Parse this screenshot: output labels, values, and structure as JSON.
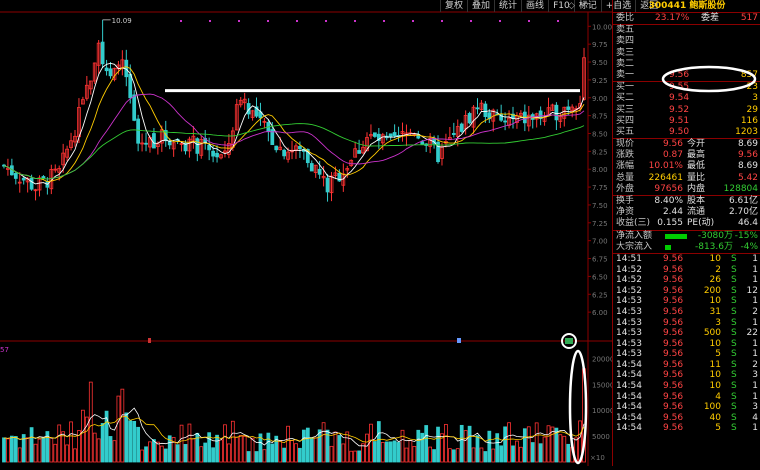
{
  "toolbar": {
    "buttons": [
      "复权",
      "叠加",
      "统计",
      "画线",
      "F10",
      "标记",
      "+自选",
      "返回"
    ],
    "icons": [
      "◇",
      "↶"
    ]
  },
  "stock": {
    "code": "300441",
    "name": "鲍斯股份",
    "code_name": "300441  鲍斯股份"
  },
  "order_book": {
    "weibi_label": "委比",
    "weibi": "23.17%",
    "weicha_label": "委差",
    "weicha": "517",
    "sells": [
      {
        "label": "卖五",
        "price": "",
        "vol": ""
      },
      {
        "label": "卖四",
        "price": "",
        "vol": ""
      },
      {
        "label": "卖三",
        "price": "",
        "vol": ""
      },
      {
        "label": "卖二",
        "price": "",
        "vol": ""
      },
      {
        "label": "卖一",
        "price": "9.56",
        "vol": "857"
      }
    ],
    "buys": [
      {
        "label": "买一",
        "price": "9.55",
        "vol": "23"
      },
      {
        "label": "买二",
        "price": "9.54",
        "vol": "3"
      },
      {
        "label": "买三",
        "price": "9.52",
        "vol": "29"
      },
      {
        "label": "买四",
        "price": "9.51",
        "vol": "116"
      },
      {
        "label": "买五",
        "price": "9.50",
        "vol": "1203"
      }
    ]
  },
  "quote": [
    {
      "l1": "现价",
      "v1": "9.56",
      "c1": "r",
      "l2": "今开",
      "v2": "8.69",
      "c2": "w"
    },
    {
      "l1": "涨跌",
      "v1": "0.87",
      "c1": "r",
      "l2": "最高",
      "v2": "9.56",
      "c2": "r"
    },
    {
      "l1": "涨幅",
      "v1": "10.01%",
      "c1": "r",
      "l2": "最低",
      "v2": "8.69",
      "c2": "w"
    },
    {
      "l1": "总量",
      "v1": "226461",
      "c1": "y",
      "l2": "量比",
      "v2": "5.42",
      "c2": "r"
    },
    {
      "l1": "外盘",
      "v1": "97656",
      "c1": "r",
      "l2": "内盘",
      "v2": "128804",
      "c2": "g"
    }
  ],
  "fundamentals": [
    {
      "l1": "换手",
      "v1": "8.40%",
      "l2": "股本",
      "v2": "6.61亿"
    },
    {
      "l1": "净资",
      "v1": "2.44",
      "l2": "流通",
      "v2": "2.70亿"
    },
    {
      "l1": "收益(三)",
      "v1": "0.155",
      "l2": "PE(动)",
      "v2": "46.4"
    }
  ],
  "flows": [
    {
      "label": "净流入额",
      "value": "-3080万",
      "pct": "-15%",
      "bar": 0.55
    },
    {
      "label": "大宗流入",
      "value": "-813.6万",
      "pct": "-4%",
      "bar": 0.15
    }
  ],
  "ticks": [
    {
      "t": "14:51",
      "p": "9.56",
      "v": "10",
      "d": "S",
      "n": "1"
    },
    {
      "t": "14:52",
      "p": "9.56",
      "v": "2",
      "d": "S",
      "n": "1"
    },
    {
      "t": "14:52",
      "p": "9.56",
      "v": "26",
      "d": "S",
      "n": "1"
    },
    {
      "t": "14:52",
      "p": "9.56",
      "v": "200",
      "d": "S",
      "n": "12"
    },
    {
      "t": "14:53",
      "p": "9.56",
      "v": "10",
      "d": "S",
      "n": "1"
    },
    {
      "t": "14:53",
      "p": "9.56",
      "v": "31",
      "d": "S",
      "n": "2"
    },
    {
      "t": "14:53",
      "p": "9.56",
      "v": "3",
      "d": "S",
      "n": "1"
    },
    {
      "t": "14:53",
      "p": "9.56",
      "v": "500",
      "d": "S",
      "n": "22"
    },
    {
      "t": "14:53",
      "p": "9.56",
      "v": "10",
      "d": "S",
      "n": "1"
    },
    {
      "t": "14:53",
      "p": "9.56",
      "v": "5",
      "d": "S",
      "n": "1"
    },
    {
      "t": "14:54",
      "p": "9.56",
      "v": "11",
      "d": "S",
      "n": "2"
    },
    {
      "t": "14:54",
      "p": "9.56",
      "v": "10",
      "d": "S",
      "n": "3"
    },
    {
      "t": "14:54",
      "p": "9.56",
      "v": "10",
      "d": "S",
      "n": "1"
    },
    {
      "t": "14:54",
      "p": "9.56",
      "v": "4",
      "d": "S",
      "n": "1"
    },
    {
      "t": "14:54",
      "p": "9.56",
      "v": "100",
      "d": "S",
      "n": "3"
    },
    {
      "t": "14:54",
      "p": "9.56",
      "v": "40",
      "d": "S",
      "n": "4"
    },
    {
      "t": "14:54",
      "p": "9.56",
      "v": "5",
      "d": "S",
      "n": "1"
    }
  ],
  "chart_data": {
    "type": "candlestick",
    "max_label": "10.09",
    "price_ticks": [
      "10.00",
      "9.75",
      "9.50",
      "9.25",
      "9.00",
      "8.75",
      "8.50",
      "8.25",
      "8.00",
      "7.75",
      "7.50",
      "7.25",
      "7.00",
      "6.75",
      "6.50",
      "6.25",
      "6.00"
    ],
    "price_range": [
      5.75,
      10.2
    ],
    "volume_ticks": [
      "20000",
      "15000",
      "10000",
      "5000"
    ],
    "volume_range": [
      0,
      22000
    ],
    "volume_label_left": "57",
    "volume_label_right": "×10",
    "resistance_price": 9.1,
    "colors": {
      "up": "#ff3333",
      "down": "#33cccc",
      "ma5": "#ffffff",
      "ma10": "#ffcc00",
      "ma20": "#cc33cc",
      "ma60": "#33cc33"
    }
  }
}
